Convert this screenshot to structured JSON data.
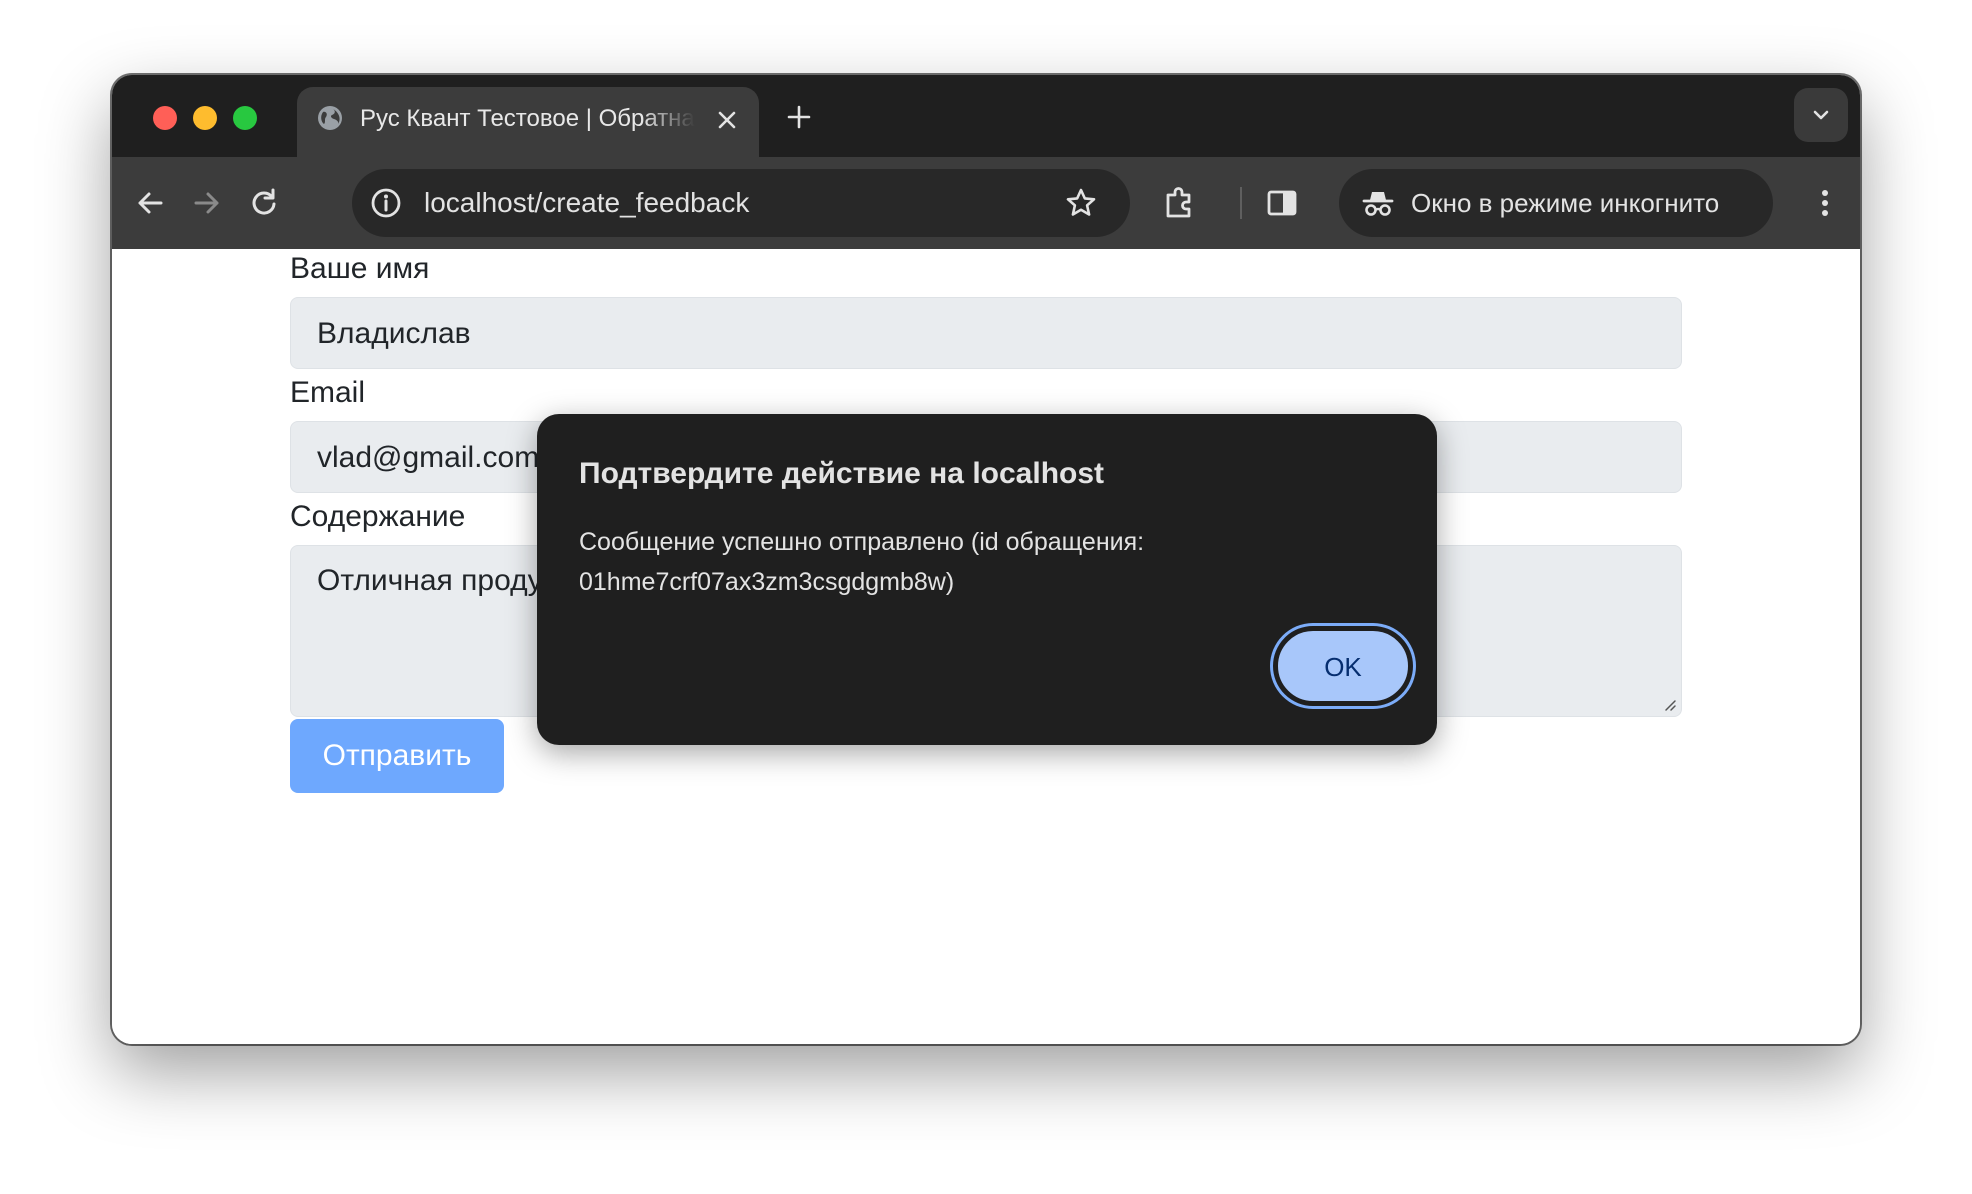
{
  "browser": {
    "tab": {
      "title": "Рус Квант Тестовое | Обратная связь",
      "favicon": "globe-icon"
    },
    "address_bar": {
      "url": "localhost/create_feedback"
    },
    "incognito": {
      "label": "Окно в режиме инкогнито"
    }
  },
  "form": {
    "name": {
      "label": "Ваше имя",
      "value": "Владислав"
    },
    "email": {
      "label": "Email",
      "value": "vlad@gmail.com"
    },
    "content": {
      "label": "Содержание",
      "value": "Отличная продукция, буду советовать!"
    },
    "submit_label": "Отправить"
  },
  "dialog": {
    "title": "Подтвердите действие на localhost",
    "message": "Сообщение успешно отправлено (id обращения:\n01hme7crf07ax3zm3csgdgmb8w)",
    "ok_label": "OK"
  },
  "colors": {
    "tabbar": "#1f1f1f",
    "toolbar": "#3c3c3c",
    "dialog_bg": "#1f1f1f",
    "ok_button": "#a8c7fa",
    "submit_button": "#6ea8fe",
    "input_bg": "#e9ecef"
  }
}
